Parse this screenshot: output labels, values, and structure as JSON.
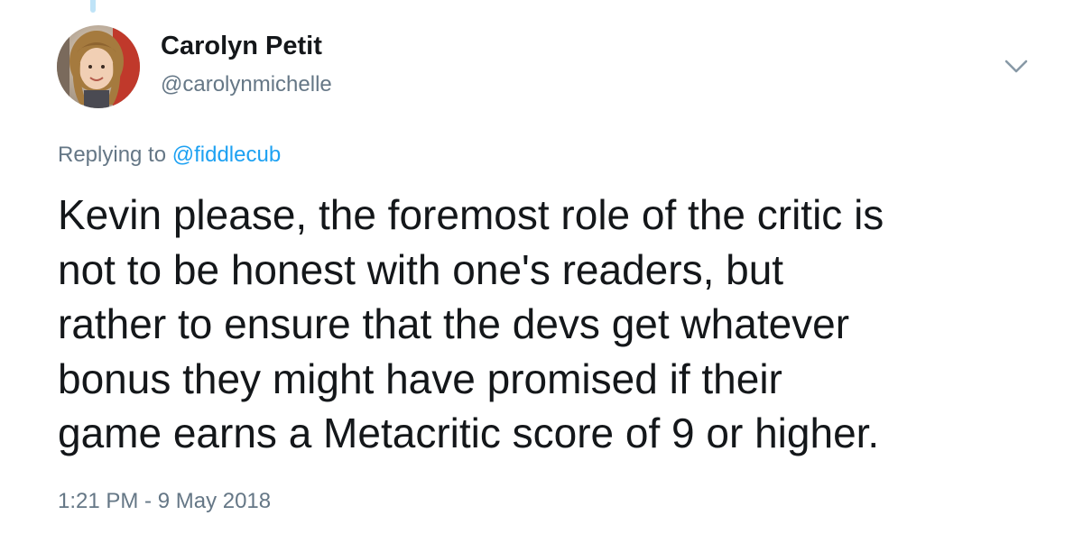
{
  "tweet": {
    "author": {
      "name": "Carolyn Petit",
      "handle": "@carolynmichelle"
    },
    "reply": {
      "prefix": "Replying to",
      "mention": "@fiddlecub"
    },
    "text_lines": [
      "Kevin please, the foremost role of the critic is",
      "not to be honest with one's readers, but",
      "rather to ensure that the devs get whatever",
      "bonus they might have promised if their",
      "game earns a Metacritic score of 9 or higher."
    ],
    "timestamp": "1:21 PM - 9 May 2018",
    "icons": {
      "more": "chevron-down-icon"
    },
    "colors": {
      "link": "#1da1f2",
      "secondary": "#657786",
      "text": "#14171a",
      "thread": "#bfe3f7"
    }
  }
}
